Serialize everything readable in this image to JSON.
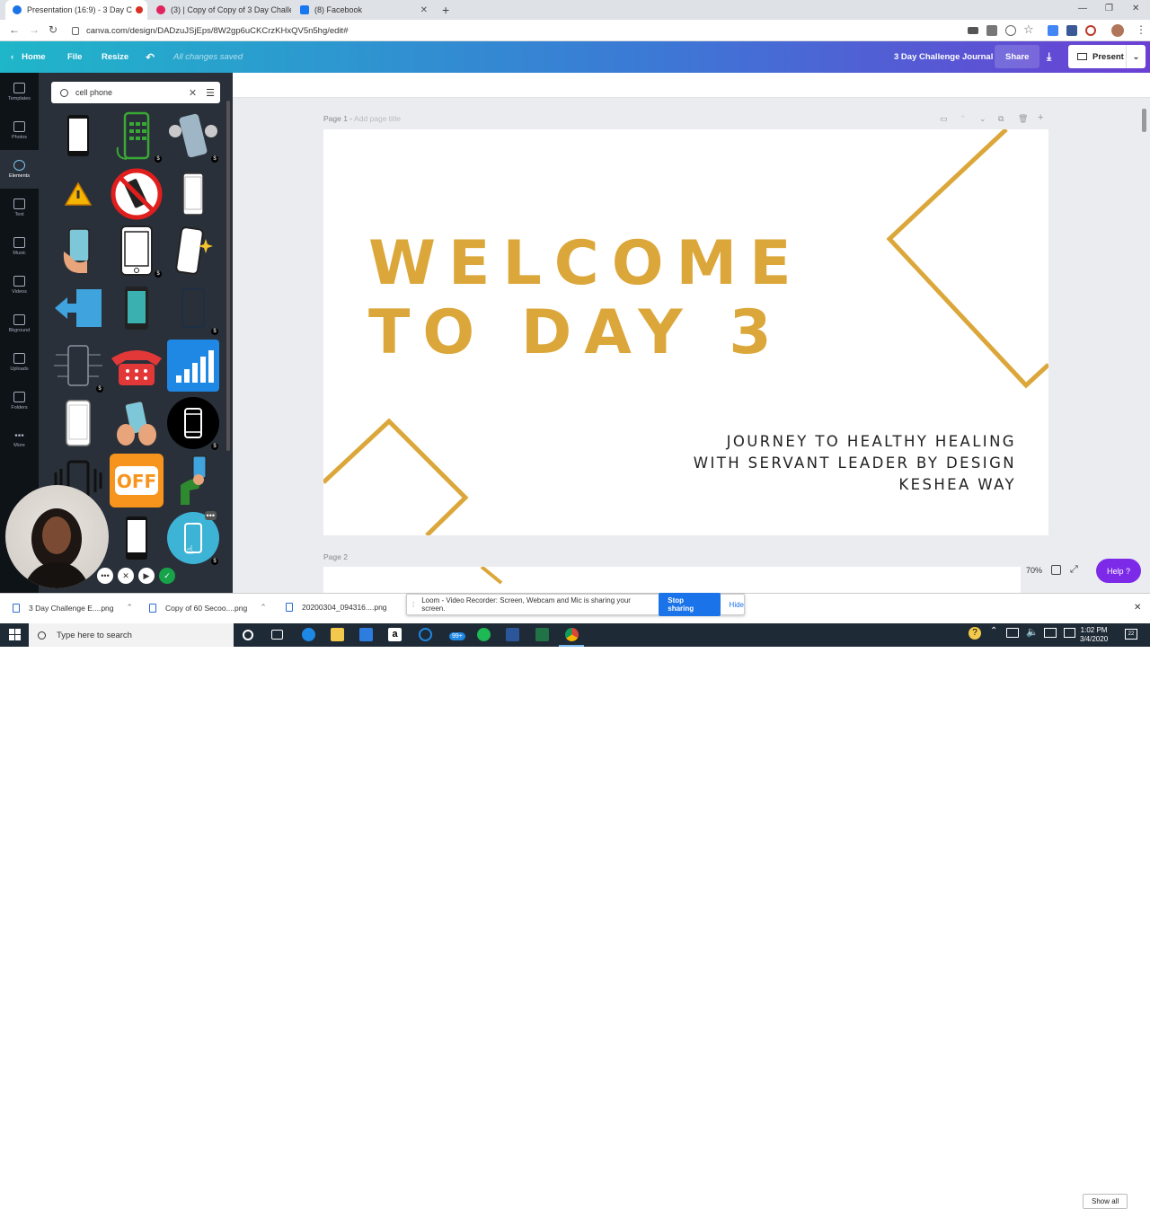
{
  "browser": {
    "tabs": [
      {
        "label": "Presentation (16:9) - 3 Day C",
        "active": true,
        "color": "#1a73e8"
      },
      {
        "label": "(3) | Copy of Copy of 3 Day Challe",
        "active": false,
        "color": "#e0245e"
      },
      {
        "label": "(8) Facebook",
        "active": false,
        "color": "#1877f2"
      }
    ],
    "new_tab": "+",
    "url": "canva.com/design/DADzuJSjEps/8W2gp6uCKCrzKHxQV5n5hg/edit#"
  },
  "canva_toolbar": {
    "home": "Home",
    "file": "File",
    "resize": "Resize",
    "saved_status": "All changes saved",
    "design_name": "3 Day Challenge Journal",
    "share": "Share",
    "present": "Present"
  },
  "sidebar": {
    "items": [
      {
        "label": "Templates"
      },
      {
        "label": "Photos"
      },
      {
        "label": "Elements",
        "active": true
      },
      {
        "label": "Text"
      },
      {
        "label": "Music"
      },
      {
        "label": "Videos"
      },
      {
        "label": "Bkground"
      },
      {
        "label": "Uploads"
      },
      {
        "label": "Folders"
      },
      {
        "label": "More"
      }
    ]
  },
  "elements_panel": {
    "search_value": "cell phone",
    "free_badge": "$"
  },
  "editor": {
    "page1_label": "Page 1 -",
    "page1_title_placeholder": "Add page title",
    "page2_label": "Page 2",
    "zoom": "70%",
    "help": "Help ?"
  },
  "slide": {
    "title_line1": "WELCOME",
    "title_line2": "TO DAY 3",
    "sub_line1": "JOURNEY TO HEALTHY HEALING",
    "sub_line2": "WITH SERVANT LEADER BY DESIGN",
    "sub_line3": "KESHEA WAY",
    "accent_color": "#dca73a"
  },
  "downloads": {
    "items": [
      {
        "label": "3 Day Challenge E....png"
      },
      {
        "label": "Copy of 60 Secoo....png"
      },
      {
        "label": "20200304_094316....png"
      }
    ],
    "show_all": "Show all"
  },
  "loom": {
    "message": "Loom - Video Recorder: Screen, Webcam and Mic is sharing your screen.",
    "stop": "Stop sharing",
    "hide": "Hide"
  },
  "taskbar": {
    "search_placeholder": "Type here to search",
    "badge": "99+",
    "time": "1:02 PM",
    "date": "3/4/2020",
    "notif_count": "22"
  }
}
